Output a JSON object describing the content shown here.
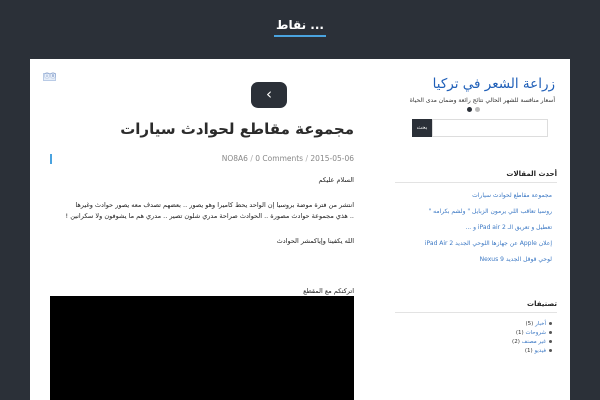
{
  "site": {
    "title": "نقاط ..."
  },
  "ad_badge": "ⓘⓧ",
  "nav": {
    "next_glyph": "‹"
  },
  "post": {
    "title": "مجموعة مقاطع لحوادث سيارات",
    "meta": {
      "author": "NO8A6",
      "comments": "0 Comments",
      "date": "2015-05-06",
      "separator": "/"
    },
    "paragraphs": [
      "السلام عليكم",
      "انتشر من فترة موضة بروسيا إن الواحد يحط كاميرا وهو يصور .. بعضهم تصدف معه يصور حوادث وغيرها",
      ".. هذي مجموعة حوادث مصورة .. الحوادث صراحة مدري شلون تصير .. مدري هم ما يشوفون ولا سكرانين !",
      "الله يكفينا وإياكمشر الحوادث",
      "اتركتكم مع المقطع"
    ]
  },
  "sidebar": {
    "ad": {
      "title": "زراعة الشعر في تركيا",
      "desc": "أسعار منافسة للشهر الحالي نتائج رائعة وضمان مدى الحياة"
    },
    "search": {
      "button": "بحث",
      "placeholder": ""
    },
    "recent": {
      "title": "أحدث المقالات",
      "items": [
        "مجموعة مقاطع لحوادث سيارات",
        "روسيا تعاقب اللي يرمون الزبايل \" ولشم بكرامه \"",
        "تعطيل و تعريق الـ iPad air 2 و ...",
        "إعلان Apple عن جهازها اللوحي الجديد iPad Air 2",
        "لوحي قوقل الجديد Nexus 9"
      ]
    },
    "categories": {
      "title": "تصنيفات",
      "items": [
        {
          "name": "أخبار",
          "count": "(5)"
        },
        {
          "name": "شروحات",
          "count": "(1)"
        },
        {
          "name": "غير مصنف",
          "count": "(2)"
        },
        {
          "name": "فيديو",
          "count": "(1)"
        }
      ]
    }
  },
  "colors": {
    "accent": "#4aa3df",
    "link": "#3b78c4",
    "dark": "#2b3038"
  }
}
